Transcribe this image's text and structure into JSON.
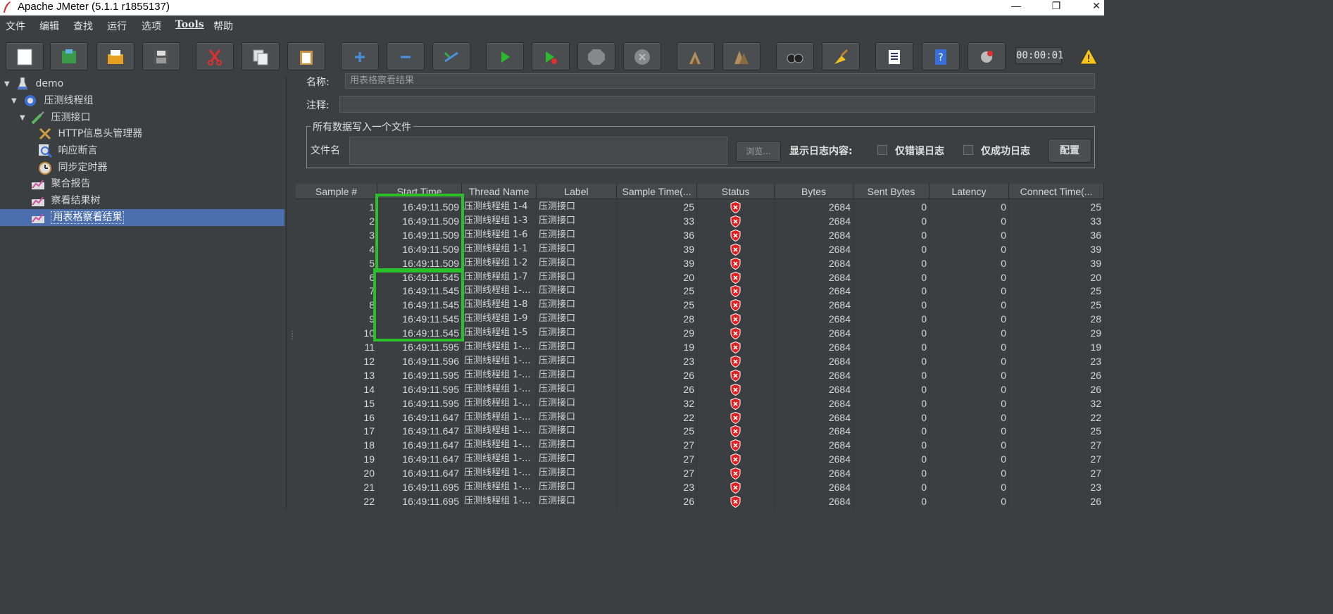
{
  "window": {
    "title": "Apache JMeter (5.1.1 r1855137)",
    "minimize": "—",
    "maximize": "❐",
    "close": "✕"
  },
  "menu": [
    "文件",
    "编辑",
    "查找",
    "运行",
    "选项",
    "Tools",
    "帮助"
  ],
  "toolbar": {
    "buttons": [
      "new-icon",
      "templates-icon",
      "open-icon",
      "save-icon",
      "cut-icon",
      "copy-icon",
      "paste-icon",
      "expand-icon",
      "collapse-icon",
      "toggle-icon",
      "start-icon",
      "start-no-timers-icon",
      "stop-icon",
      "shutdown-icon",
      "clear-icon",
      "clear-all-icon",
      "search-icon",
      "reset-search-icon",
      "function-helper-icon",
      "help-icon",
      "remote-icon"
    ],
    "timer": "00:00:01"
  },
  "tree": {
    "items": [
      {
        "label": "demo",
        "icon": "test-plan-icon"
      },
      {
        "label": "压测线程组",
        "icon": "thread-group-icon"
      },
      {
        "label": "压测接口",
        "icon": "sampler-icon"
      },
      {
        "label": "HTTP信息头管理器",
        "icon": "header-manager-icon"
      },
      {
        "label": "响应断言",
        "icon": "assertion-icon"
      },
      {
        "label": "同步定时器",
        "icon": "timer-icon"
      },
      {
        "label": "聚合报告",
        "icon": "listener-icon"
      },
      {
        "label": "察看结果树",
        "icon": "listener-icon"
      },
      {
        "label": "用表格察看结果",
        "icon": "listener-icon"
      }
    ]
  },
  "panel": {
    "name_label": "名称:",
    "name_value": "用表格察看结果",
    "comment_label": "注释:",
    "comment_value": "",
    "file_group_title": "所有数据写入一个文件",
    "filename_label": "文件名",
    "filename_value": "",
    "browse_label": "浏览...",
    "log_display_label": "显示日志内容:",
    "errors_only_label": "仅错误日志",
    "success_only_label": "仅成功日志",
    "configure_label": "配置"
  },
  "table": {
    "columns": [
      "Sample #",
      "Start Time",
      "Thread Name",
      "Label",
      "Sample Time(...",
      "Status",
      "Bytes",
      "Sent Bytes",
      "Latency",
      "Connect Time(..."
    ],
    "status_icon": "error-shield-icon",
    "rows": [
      [
        "1",
        "16:49:11.509",
        "压测线程组 1-4",
        "压测接口",
        "25",
        "2684",
        "0",
        "0",
        "25"
      ],
      [
        "2",
        "16:49:11.509",
        "压测线程组 1-3",
        "压测接口",
        "33",
        "2684",
        "0",
        "0",
        "33"
      ],
      [
        "3",
        "16:49:11.509",
        "压测线程组 1-6",
        "压测接口",
        "36",
        "2684",
        "0",
        "0",
        "36"
      ],
      [
        "4",
        "16:49:11.509",
        "压测线程组 1-1",
        "压测接口",
        "39",
        "2684",
        "0",
        "0",
        "39"
      ],
      [
        "5",
        "16:49:11.509",
        "压测线程组 1-2",
        "压测接口",
        "39",
        "2684",
        "0",
        "0",
        "39"
      ],
      [
        "6",
        "16:49:11.545",
        "压测线程组 1-7",
        "压测接口",
        "20",
        "2684",
        "0",
        "0",
        "20"
      ],
      [
        "7",
        "16:49:11.545",
        "压测线程组 1-...",
        "压测接口",
        "25",
        "2684",
        "0",
        "0",
        "25"
      ],
      [
        "8",
        "16:49:11.545",
        "压测线程组 1-8",
        "压测接口",
        "25",
        "2684",
        "0",
        "0",
        "25"
      ],
      [
        "9",
        "16:49:11.545",
        "压测线程组 1-9",
        "压测接口",
        "28",
        "2684",
        "0",
        "0",
        "28"
      ],
      [
        "10",
        "16:49:11.545",
        "压测线程组 1-5",
        "压测接口",
        "29",
        "2684",
        "0",
        "0",
        "29"
      ],
      [
        "11",
        "16:49:11.595",
        "压测线程组 1-...",
        "压测接口",
        "19",
        "2684",
        "0",
        "0",
        "19"
      ],
      [
        "12",
        "16:49:11.596",
        "压测线程组 1-...",
        "压测接口",
        "23",
        "2684",
        "0",
        "0",
        "23"
      ],
      [
        "13",
        "16:49:11.595",
        "压测线程组 1-...",
        "压测接口",
        "26",
        "2684",
        "0",
        "0",
        "26"
      ],
      [
        "14",
        "16:49:11.595",
        "压测线程组 1-...",
        "压测接口",
        "26",
        "2684",
        "0",
        "0",
        "26"
      ],
      [
        "15",
        "16:49:11.595",
        "压测线程组 1-...",
        "压测接口",
        "32",
        "2684",
        "0",
        "0",
        "32"
      ],
      [
        "16",
        "16:49:11.647",
        "压测线程组 1-...",
        "压测接口",
        "22",
        "2684",
        "0",
        "0",
        "22"
      ],
      [
        "17",
        "16:49:11.647",
        "压测线程组 1-...",
        "压测接口",
        "25",
        "2684",
        "0",
        "0",
        "25"
      ],
      [
        "18",
        "16:49:11.647",
        "压测线程组 1-...",
        "压测接口",
        "27",
        "2684",
        "0",
        "0",
        "27"
      ],
      [
        "19",
        "16:49:11.647",
        "压测线程组 1-...",
        "压测接口",
        "27",
        "2684",
        "0",
        "0",
        "27"
      ],
      [
        "20",
        "16:49:11.647",
        "压测线程组 1-...",
        "压测接口",
        "27",
        "2684",
        "0",
        "0",
        "27"
      ],
      [
        "21",
        "16:49:11.695",
        "压测线程组 1-...",
        "压测接口",
        "23",
        "2684",
        "0",
        "0",
        "23"
      ],
      [
        "22",
        "16:49:11.695",
        "压测线程组 1-...",
        "压测接口",
        "26",
        "2684",
        "0",
        "0",
        "26"
      ]
    ]
  }
}
